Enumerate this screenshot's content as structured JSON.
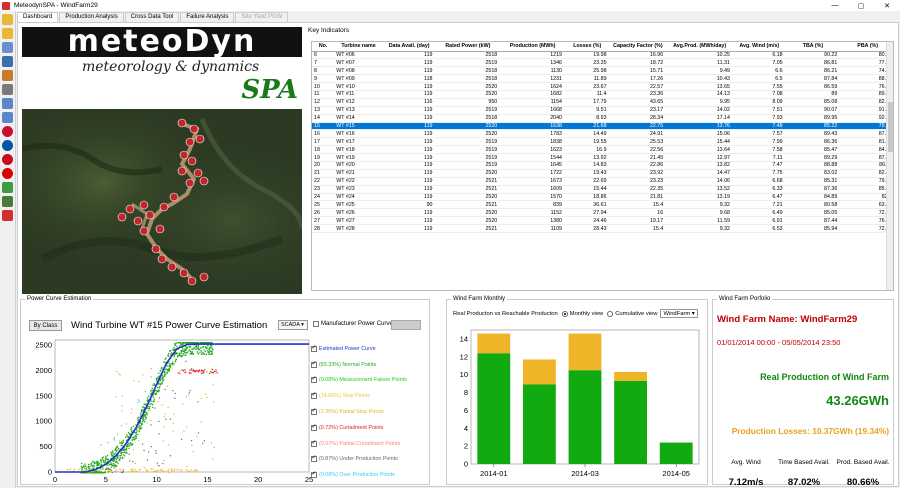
{
  "window": {
    "title": "MeteodynSPA - WindFarm29",
    "controls": [
      "—",
      "▢",
      "✕"
    ]
  },
  "toolbar": {
    "icons": [
      "folder-icon",
      "open-folder-icon",
      "document-icon",
      "function-icon",
      "settings-icon",
      "tools-icon",
      "document-icon",
      "export-icon",
      "uk-flag-icon",
      "france-flag-icon",
      "spain-flag-icon",
      "portugal-flag-icon",
      "map-icon",
      "search-icon",
      "close-icon"
    ],
    "colors": [
      "#e6b833",
      "#e6b833",
      "#6a8fcf",
      "#3a6fb0",
      "#c77c2a",
      "#7a7a7a",
      "#5b86c9",
      "#5b86c9",
      "#c8102e",
      "#0055a4",
      "#c60b1e",
      "#d90000",
      "#3f9b3f",
      "#4a7a3a",
      "#d32f2f"
    ]
  },
  "tabs": [
    {
      "label": "Dashboard",
      "active": true
    },
    {
      "label": "Production Analysis"
    },
    {
      "label": "Cross Data Tool"
    },
    {
      "label": "Failure Analysis"
    },
    {
      "label": "Site Yield PGW",
      "disabled": true
    }
  ],
  "logo": {
    "brand": "meteoDyn",
    "tagline": "meteorology & dynamics",
    "product": "SPA"
  },
  "key_indicators": {
    "title": "Key Indicators",
    "columns": [
      "No.",
      "Turbine name",
      "Data Avail. (day)",
      "Rated Power (kW)",
      "Production (MWh)",
      "Losses (%)",
      "Capacity Factor (%)",
      "Avg.Prod. (MWh/day)",
      "Avg. Wind (m/s)",
      "TBA (%)",
      "PBA (%)"
    ],
    "rows": [
      [
        "6",
        "WT #06",
        "119",
        "2518",
        "1219",
        "19.98",
        "16.96",
        "10.25",
        "6.18",
        "90.22",
        "80.93"
      ],
      [
        "7",
        "WT #07",
        "119",
        "2519",
        "1346",
        "23.35",
        "18.72",
        "11.31",
        "7.05",
        "86.81",
        "77.33"
      ],
      [
        "8",
        "WT #08",
        "119",
        "2518",
        "1130",
        "25.98",
        "15.71",
        "9.49",
        "6.6",
        "86.21",
        "74.86"
      ],
      [
        "9",
        "WT #09",
        "118",
        "2518",
        "1231",
        "11.89",
        "17.26",
        "10.43",
        "6.5",
        "87.84",
        "88.62"
      ],
      [
        "10",
        "WT #10",
        "119",
        "2520",
        "1624",
        "23.67",
        "22.57",
        "13.65",
        "7.55",
        "86.59",
        "76.87"
      ],
      [
        "11",
        "WT #11",
        "119",
        "2520",
        "1682",
        "11.4",
        "23.36",
        "14.13",
        "7.08",
        "89",
        "89.82"
      ],
      [
        "12",
        "WT #12",
        "116",
        "950",
        "1154",
        "17.79",
        "43.65",
        "9.95",
        "8.09",
        "85.08",
        "82.69"
      ],
      [
        "13",
        "WT #13",
        "119",
        "2519",
        "1668",
        "9.51",
        "23.17",
        "14.02",
        "7.51",
        "90.07",
        "91.67"
      ],
      [
        "14",
        "WT #14",
        "119",
        "2518",
        "2040",
        "8.93",
        "28.34",
        "17.14",
        "7.93",
        "89.95",
        "92.15"
      ],
      [
        "15",
        "WT #15",
        "119",
        "2520",
        "1638",
        "21.68",
        "22.75",
        "13.76",
        "7.48",
        "85.22",
        "79.61"
      ],
      [
        "16",
        "WT #16",
        "119",
        "2520",
        "1783",
        "14.49",
        "24.91",
        "15.06",
        "7.57",
        "89.43",
        "87.13"
      ],
      [
        "17",
        "WT #17",
        "119",
        "2519",
        "1838",
        "19.55",
        "25.53",
        "15.44",
        "7.99",
        "86.36",
        "81.52"
      ],
      [
        "18",
        "WT #18",
        "119",
        "2519",
        "1623",
        "16.9",
        "22.56",
        "13.64",
        "7.58",
        "85.47",
        "84.21"
      ],
      [
        "19",
        "WT #19",
        "119",
        "2519",
        "1544",
        "13.92",
        "21.45",
        "12.97",
        "7.11",
        "89.29",
        "87.25"
      ],
      [
        "20",
        "WT #20",
        "119",
        "2519",
        "1645",
        "14.83",
        "22.86",
        "13.82",
        "7.47",
        "88.88",
        "86.11"
      ],
      [
        "21",
        "WT #21",
        "119",
        "2520",
        "1722",
        "19.43",
        "23.92",
        "14.47",
        "7.75",
        "83.02",
        "82.24"
      ],
      [
        "22",
        "WT #22",
        "119",
        "2521",
        "1673",
        "22.69",
        "23.23",
        "14.06",
        "6.68",
        "85.31",
        "79.01"
      ],
      [
        "23",
        "WT #23",
        "119",
        "2521",
        "1609",
        "15.44",
        "22.35",
        "13.52",
        "6.33",
        "87.36",
        "85.21"
      ],
      [
        "24",
        "WT #24",
        "119",
        "2520",
        "1570",
        "18.86",
        "21.81",
        "13.19",
        "6.47",
        "84.89",
        "82.2"
      ],
      [
        "25",
        "WT #25",
        "90",
        "2521",
        "839",
        "36.61",
        "15.4",
        "9.32",
        "7.21",
        "80.58",
        "63.77"
      ],
      [
        "26",
        "WT #26",
        "119",
        "2520",
        "1152",
        "27.94",
        "16",
        "9.68",
        "6.49",
        "85.05",
        "72.91"
      ],
      [
        "27",
        "WT #27",
        "119",
        "2520",
        "1380",
        "24.46",
        "19.17",
        "11.59",
        "6.91",
        "87.44",
        "76.54"
      ],
      [
        "28",
        "WT #28",
        "119",
        "2521",
        "1109",
        "28.43",
        "15.4",
        "9.32",
        "6.53",
        "85.94",
        "72.49"
      ]
    ],
    "selected_index": 9
  },
  "power_curve": {
    "group_title": "Power Curve Estimation",
    "by_class_label": "By Class",
    "title": "Wind Turbine WT #15 Power Curve Estimation",
    "source": "SCADA",
    "manufacturer_label": "Manufacturer Power Curve",
    "legend": [
      {
        "label": "Estimated Power Curve",
        "color": "#2233cc"
      },
      {
        "label": "(83.33%) Normal Points",
        "color": "#22aa22"
      },
      {
        "label": "(0.08%) Measurement Failure Points",
        "color": "#22cc22"
      },
      {
        "label": "(14.60%) Stop Points",
        "color": "#f0c040"
      },
      {
        "label": "(1.35%) Partial Stop Points",
        "color": "#e8b030"
      },
      {
        "label": "(0.72%) Curtailment Points",
        "color": "#dd2222"
      },
      {
        "label": "(0.07%) Partial Curtailment Points",
        "color": "#ff8080"
      },
      {
        "label": "(0.87%) Under Production Points",
        "color": "#666666"
      },
      {
        "label": "(0.08%) Over Production Points",
        "color": "#33ccee"
      }
    ],
    "chart_data": {
      "type": "scatter",
      "xlim": [
        0,
        25
      ],
      "ylim": [
        0,
        2600
      ],
      "xticks": [
        0,
        5,
        10,
        15,
        20,
        25
      ],
      "yticks": [
        0,
        500,
        1000,
        1500,
        2000,
        2500
      ],
      "curve_x": [
        0,
        3,
        4,
        5,
        6,
        7,
        8,
        9,
        10,
        11,
        12,
        13,
        14,
        15,
        20,
        25
      ],
      "curve_y": [
        0,
        0,
        50,
        150,
        320,
        560,
        880,
        1280,
        1720,
        2150,
        2430,
        2510,
        2520,
        2520,
        2520,
        2520
      ]
    }
  },
  "wind_farm_monthly": {
    "group_title": "Wind Farm Monthly",
    "subtitle": "Real Producton vs Reachable Producton",
    "monthly_label": "Monthly view",
    "cumulative_label": "Cumulative view",
    "scope": "WindFarm",
    "chart_data": {
      "type": "bar",
      "stacked": true,
      "categories": [
        "2014-01",
        "2014-02",
        "2014-03",
        "2014-04",
        "2014-05"
      ],
      "xtick_labels": [
        "2014-01",
        "",
        "2014-03",
        "",
        "2014-05"
      ],
      "series": [
        {
          "values": [
            12.4,
            8.9,
            10.5,
            9.3,
            2.4
          ],
          "color": "#11aa11"
        },
        {
          "values": [
            2.2,
            2.8,
            4.1,
            1.0,
            0
          ],
          "color": "#f0b429"
        }
      ],
      "ylim": [
        0,
        15
      ],
      "yticks": [
        0,
        2,
        4,
        6,
        8,
        10,
        12,
        14
      ]
    }
  },
  "portfolio": {
    "group_title": "Wind Farm Porfolio",
    "name": "Wind Farm Name: WindFarm29",
    "dates": "01/01/2014 00:00 - 05/05/2014 23:50",
    "real_production_label": "Real Production of Wind Farm",
    "real_production_value": "43.26GWh",
    "losses": "Production Losses: 10.37GWh (19.34%)",
    "kpis": [
      {
        "label": "Avg. Wind",
        "value": "7.12m/s"
      },
      {
        "label": "Time Based Avail.",
        "value": "87.02%"
      },
      {
        "label": "Prod. Based Avail.",
        "value": "80.66%"
      }
    ]
  }
}
